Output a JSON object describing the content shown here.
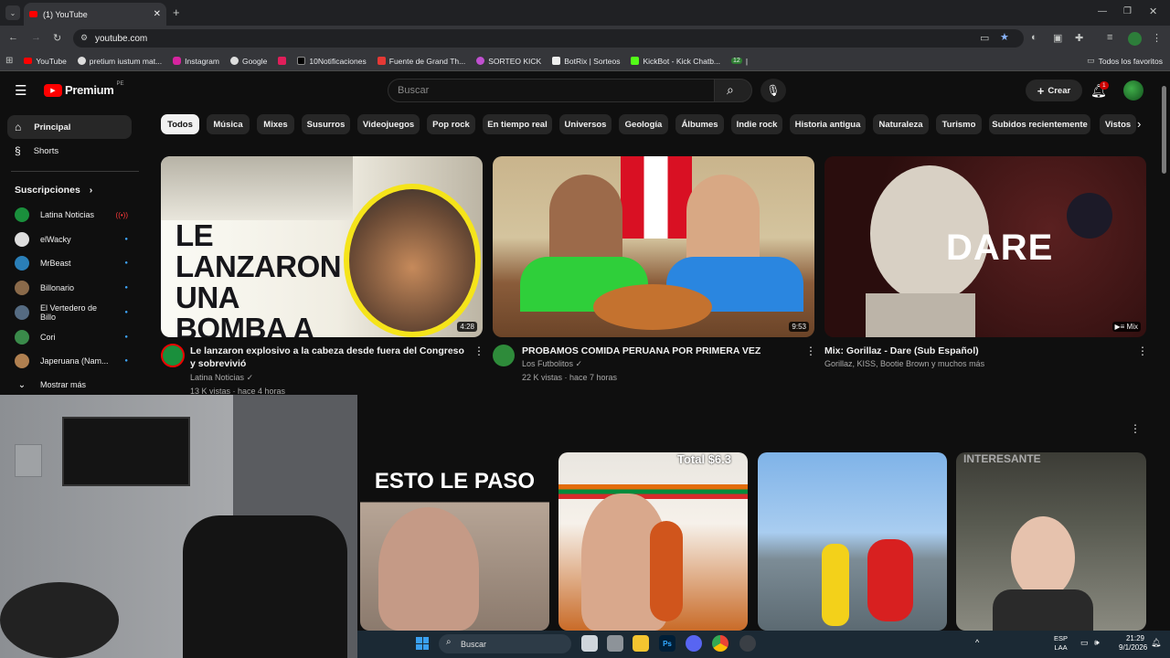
{
  "browser": {
    "tab_title": "(1) YouTube",
    "url": "youtube.com",
    "bookmarks": [
      "YouTube",
      "pretium iustum mat...",
      "Instagram",
      "Google",
      "",
      "10Notificaciones",
      "Fuente de Grand Th...",
      "SORTEO KICK",
      "BotRix | Sorteos",
      "KickBot - Kick Chatb...",
      "12",
      "|"
    ],
    "all_bookmarks": "Todos los favoritos"
  },
  "header": {
    "logo": "Premium",
    "region": "PE",
    "search_placeholder": "Buscar",
    "create_label": "Crear",
    "notifications": "1"
  },
  "sidebar": {
    "home": "Principal",
    "shorts": "Shorts",
    "subs_title": "Suscripciones",
    "subs": [
      {
        "name": "Latina Noticias",
        "color": "#1a8f3c",
        "live": true
      },
      {
        "name": "elWacky",
        "color": "#dddddd",
        "live": false
      },
      {
        "name": "MrBeast",
        "color": "#2a7fb8",
        "live": false
      },
      {
        "name": "Billonario",
        "color": "#8a6a4a",
        "live": false
      },
      {
        "name": "El Vertedero de Billo",
        "color": "#556b82",
        "live": false
      },
      {
        "name": "Cori",
        "color": "#3a8a4a",
        "live": false
      },
      {
        "name": "Japeruana (Nam...",
        "color": "#b08050",
        "live": false
      }
    ],
    "more": "Mostrar más"
  },
  "chips": [
    "Todos",
    "Música",
    "Mixes",
    "Susurros",
    "Videojuegos",
    "Pop rock",
    "En tiempo real",
    "Universos",
    "Geología",
    "Álbumes",
    "Indie rock",
    "Historia antigua",
    "Naturaleza",
    "Turismo",
    "Subidos recientemente",
    "Vistos"
  ],
  "videos": [
    {
      "title": "Le lanzaron explosivo a la cabeza desde fuera del Congreso y sobrevivió",
      "channel": "Latina Noticias",
      "meta": "13 K vistas · hace 4 horas",
      "duration": "4:28",
      "thumb_text": "LE LANZARON UNA BOMBA A LA CABEZA"
    },
    {
      "title": "PROBAMOS COMIDA PERUANA POR PRIMERA VEZ",
      "channel": "Los Futbolitos",
      "meta": "22 K vistas · hace 7 horas",
      "duration": "9:53"
    },
    {
      "title": "Mix: Gorillaz - Dare (Sub Español)",
      "channel": "Gorillaz, KISS, Bootie Brown y muchos más",
      "meta": "",
      "duration": "Mix",
      "thumb_text": "DARE"
    }
  ],
  "shorts_row": [
    {
      "thumb_text": "ESTO LE PASO"
    },
    {
      "thumb_text": "Total $6.3"
    },
    {
      "thumb_text": ""
    },
    {
      "thumb_text": "INTERESANTE"
    }
  ],
  "taskbar": {
    "search": "Buscar",
    "lang": "ESP",
    "lang2": "LAA",
    "time": "21:29",
    "date": "9/1/2026"
  },
  "colors": {
    "brand": "#ff0000",
    "bg": "#0f0f0f",
    "chip_active": "#f1f1f1"
  }
}
